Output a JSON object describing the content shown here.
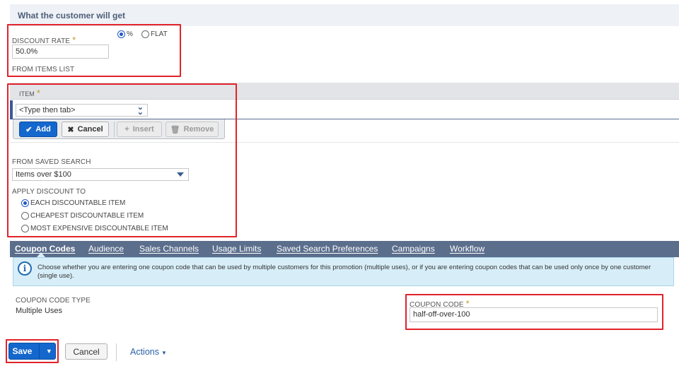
{
  "section": {
    "title": "What the customer will get"
  },
  "discount": {
    "label": "DISCOUNT RATE",
    "required_mark": "*",
    "value": "50.0%",
    "type_options": [
      {
        "label": "%",
        "selected": true
      },
      {
        "label": "FLAT",
        "selected": false
      }
    ],
    "from_items_label": "FROM ITEMS LIST"
  },
  "items_sublist": {
    "column_label": "ITEM",
    "required_mark": "*",
    "item_select_value": "<Type then tab>",
    "buttons": {
      "add": "Add",
      "cancel": "Cancel",
      "insert": "Insert",
      "remove": "Remove"
    }
  },
  "saved_search": {
    "label": "FROM SAVED SEARCH",
    "value": "Items over $100"
  },
  "apply_discount": {
    "label": "APPLY DISCOUNT TO",
    "options": [
      {
        "label": "EACH DISCOUNTABLE ITEM",
        "selected": true
      },
      {
        "label": "CHEAPEST DISCOUNTABLE ITEM",
        "selected": false
      },
      {
        "label": "MOST EXPENSIVE DISCOUNTABLE ITEM",
        "selected": false
      }
    ]
  },
  "tabs": [
    {
      "label": "Coupon Codes",
      "active": true
    },
    {
      "label": "Audience",
      "active": false
    },
    {
      "label": "Sales Channels",
      "active": false
    },
    {
      "label": "Usage Limits",
      "active": false
    },
    {
      "label": "Saved Search Preferences",
      "active": false
    },
    {
      "label": "Campaigns",
      "active": false
    },
    {
      "label": "Workflow",
      "active": false
    }
  ],
  "info": {
    "icon": "info-icon",
    "text": "Choose whether you are entering one coupon code that can be used by multiple customers for this promotion (multiple uses), or if you are entering coupon codes that can be used only once by one customer (single use)."
  },
  "coupon": {
    "type_label": "COUPON CODE TYPE",
    "type_value": "Multiple Uses",
    "code_label": "COUPON CODE",
    "required_mark": "*",
    "code_value": "half-off-over-100"
  },
  "footer": {
    "save": "Save",
    "cancel": "Cancel",
    "actions": "Actions"
  },
  "colors": {
    "highlight": "#e2222a",
    "primary": "#1467cc",
    "tabbar": "#5b6e8c",
    "info_bg": "#d7eef8",
    "required": "#c69b2b"
  }
}
